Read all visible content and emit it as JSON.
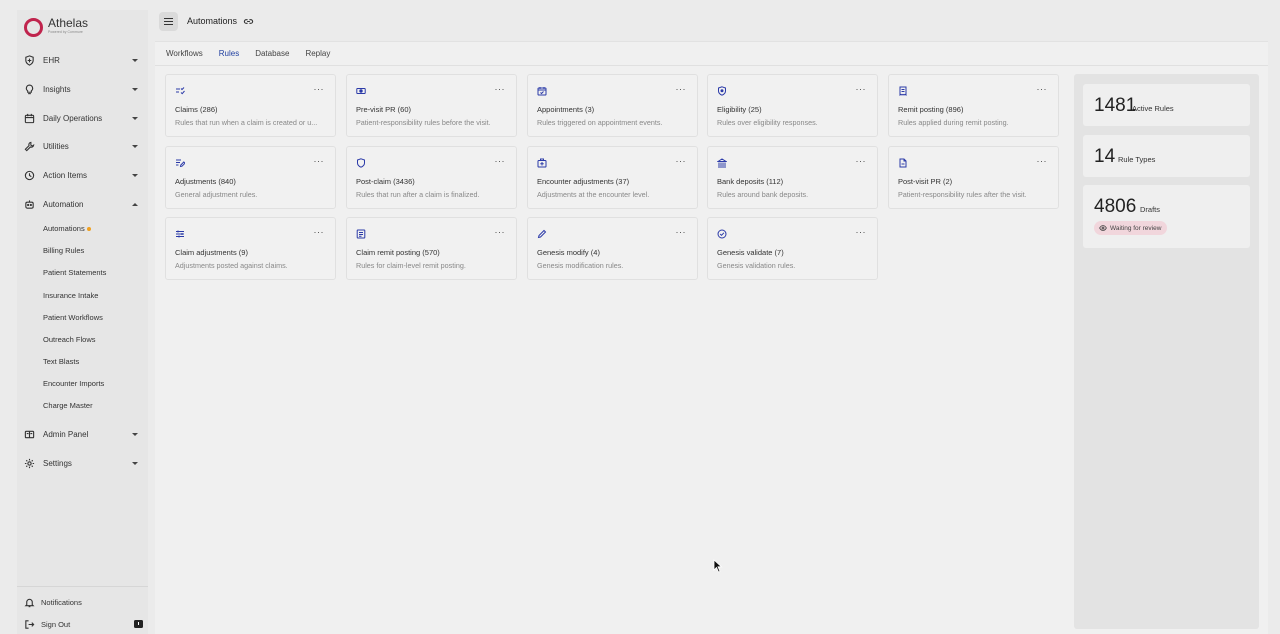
{
  "brand": {
    "name": "Athelas",
    "sub": "Powered by Commure",
    "color": "#c0244d"
  },
  "sidebar": {
    "items": [
      {
        "label": "EHR",
        "icon": "shield-plus-icon"
      },
      {
        "label": "Insights",
        "icon": "lightbulb-icon"
      },
      {
        "label": "Daily Operations",
        "icon": "calendar-icon"
      },
      {
        "label": "Utilities",
        "icon": "wrench-icon"
      },
      {
        "label": "Action Items",
        "icon": "clock-icon"
      },
      {
        "label": "Automation",
        "icon": "robot-icon"
      },
      {
        "label": "Admin Panel",
        "icon": "book-icon"
      },
      {
        "label": "Settings",
        "icon": "gear-icon"
      }
    ],
    "automation_sub": [
      "Automations",
      "Billing Rules",
      "Patient Statements",
      "Insurance Intake",
      "Patient Workflows",
      "Outreach Flows",
      "Text Blasts",
      "Encounter Imports",
      "Charge Master"
    ],
    "bottom": {
      "notifications": "Notifications",
      "sign_out": "Sign Out"
    }
  },
  "header": {
    "title": "Automations"
  },
  "tabs": [
    "Workflows",
    "Rules",
    "Database",
    "Replay"
  ],
  "active_tab": "Rules",
  "cards": [
    {
      "title": "Claims (286)",
      "desc": "Rules that run when a claim is created or u...",
      "icon": "checklist-icon"
    },
    {
      "title": "Pre-visit PR (60)",
      "desc": "Patient-responsibility rules before the visit.",
      "icon": "cash-icon"
    },
    {
      "title": "Appointments (3)",
      "desc": "Rules triggered on appointment events.",
      "icon": "calendar-check-icon"
    },
    {
      "title": "Eligibility (25)",
      "desc": "Rules over eligibility responses.",
      "icon": "shield-icon"
    },
    {
      "title": "Remit posting (896)",
      "desc": "Rules applied during remit posting.",
      "icon": "receipt-icon"
    },
    {
      "title": "Adjustments (840)",
      "desc": "General adjustment rules.",
      "icon": "edit-list-icon"
    },
    {
      "title": "Post-claim (3436)",
      "desc": "Rules that run after a claim is finalized.",
      "icon": "shield-outline-icon"
    },
    {
      "title": "Encounter adjustments (37)",
      "desc": "Adjustments at the encounter level.",
      "icon": "medical-bag-icon"
    },
    {
      "title": "Bank deposits (112)",
      "desc": "Rules around bank deposits.",
      "icon": "bank-icon"
    },
    {
      "title": "Post-visit PR (2)",
      "desc": "Patient-responsibility rules after the visit.",
      "icon": "document-icon"
    },
    {
      "title": "Claim adjustments (9)",
      "desc": "Adjustments posted against claims.",
      "icon": "sliders-icon"
    },
    {
      "title": "Claim remit posting (570)",
      "desc": "Rules for claim-level remit posting.",
      "icon": "list-box-icon"
    },
    {
      "title": "Genesis modify (4)",
      "desc": "Genesis modification rules.",
      "icon": "pencil-icon"
    },
    {
      "title": "Genesis validate (7)",
      "desc": "Genesis validation rules.",
      "icon": "check-circle-icon"
    }
  ],
  "card_menu": "···",
  "stats": [
    {
      "value": "1481",
      "label": "Active Rules"
    },
    {
      "value": "14",
      "label": "Rule Types"
    },
    {
      "value": "4806",
      "label": "Drafts",
      "badge": "Waiting for review"
    }
  ],
  "colors": {
    "accent": "#1f3fa0",
    "icon": "#2b3aa8",
    "badge_bg": "#f1d6dc",
    "dot": "#f0a020"
  }
}
